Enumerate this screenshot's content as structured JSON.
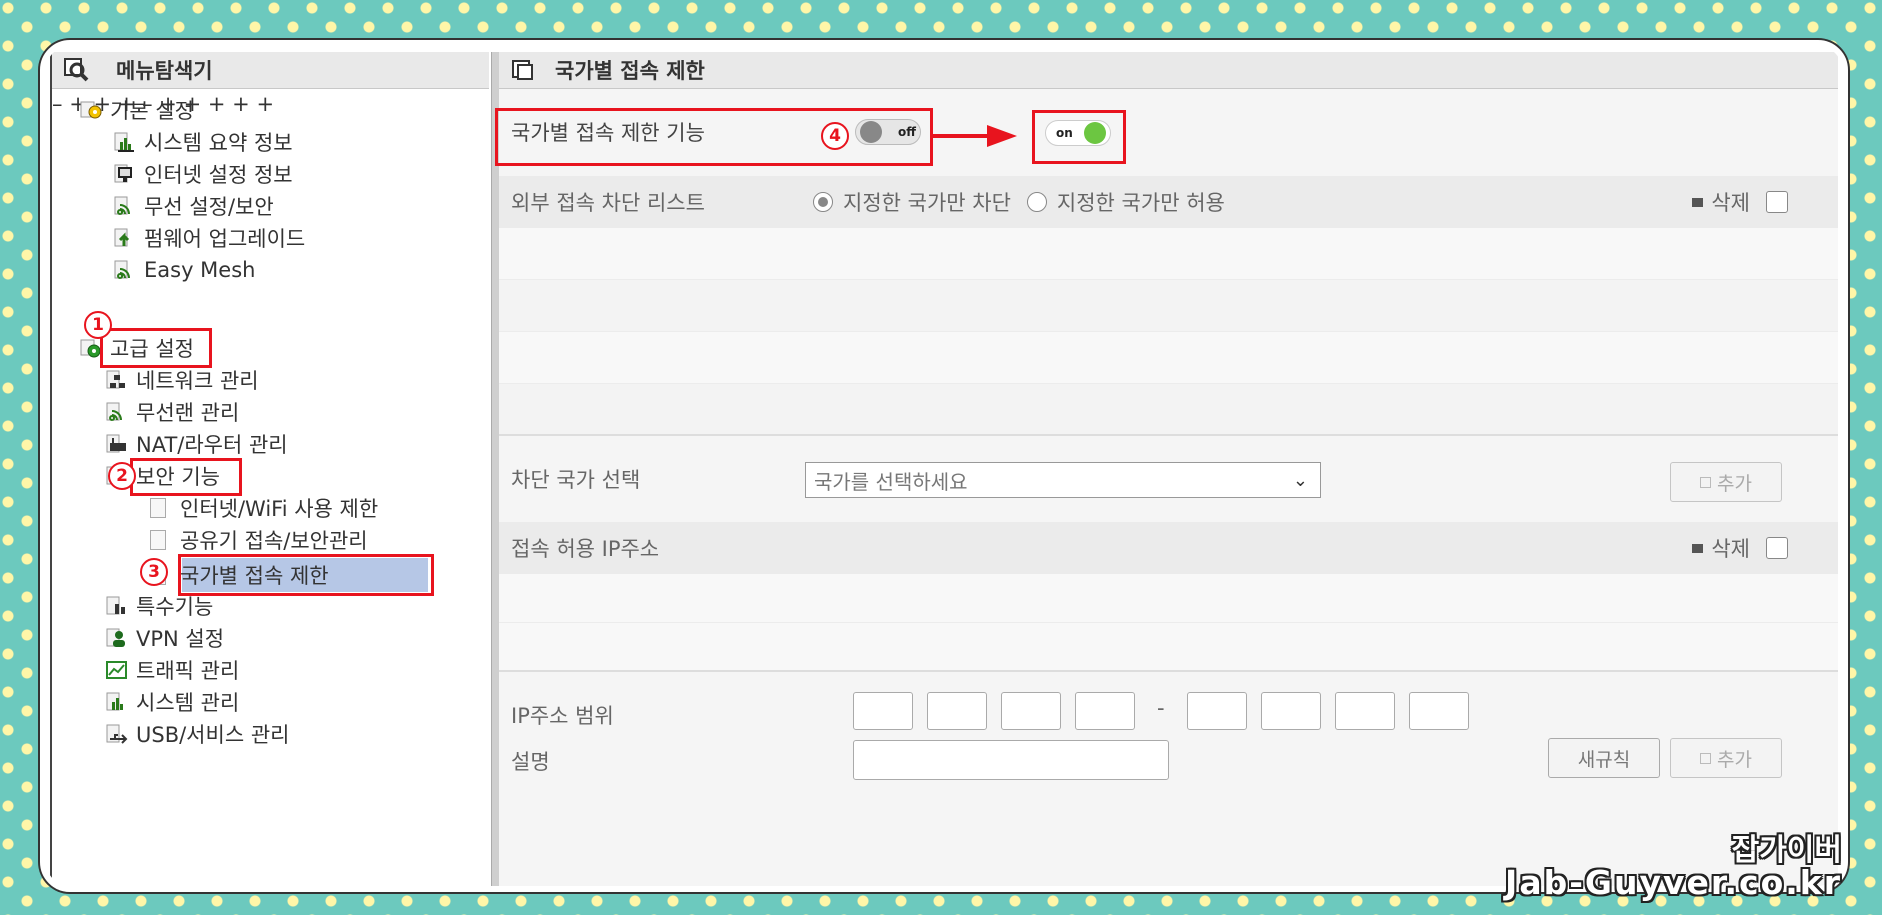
{
  "sidebar": {
    "title": "메뉴탐색기",
    "basic": {
      "label": "기본 설정",
      "items": [
        "시스템 요약 정보",
        "인터넷 설정 정보",
        "무선 설정/보안",
        "펌웨어 업그레이드",
        "Easy Mesh"
      ]
    },
    "advanced": {
      "label": "고급 설정",
      "items": [
        "네트워크 관리",
        "무선랜 관리",
        "NAT/라우터 관리"
      ],
      "security": {
        "label": "보안 기능",
        "items": [
          "인터넷/WiFi 사용 제한",
          "공유기 접속/보안관리",
          "국가별 접속 제한"
        ]
      },
      "more_items": [
        "특수기능",
        "VPN 설정",
        "트래픽 관리",
        "시스템 관리",
        "USB/서비스 관리"
      ]
    }
  },
  "main": {
    "title": "국가별 접속 제한",
    "feature_label": "국가별 접속 제한 기능",
    "toggle_off_text": "off",
    "toggle_on_text": "on",
    "block_list_label": "외부 접속 차단 리스트",
    "radio_block": "지정한 국가만 차단",
    "radio_allow": "지정한 국가만 허용",
    "delete_label": "삭제",
    "country_select_label": "차단 국가 선택",
    "country_select_placeholder": "국가를 선택하세요",
    "add_label": "추가",
    "allowed_ip_label": "접속 허용 IP주소",
    "ip_range_label": "IP주소 범위",
    "ip_dash": "-",
    "description_label": "설명",
    "refresh_label": "새규칙"
  },
  "annotations": {
    "n1": "1",
    "n2": "2",
    "n3": "3",
    "n4": "4"
  },
  "watermark": {
    "line1": "잡가이버",
    "line2": "Jab-Guyver.co.kr"
  },
  "colors": {
    "annotation": "#e8141e",
    "toggle_on": "#6cc641",
    "selected": "#b6c7e6"
  }
}
